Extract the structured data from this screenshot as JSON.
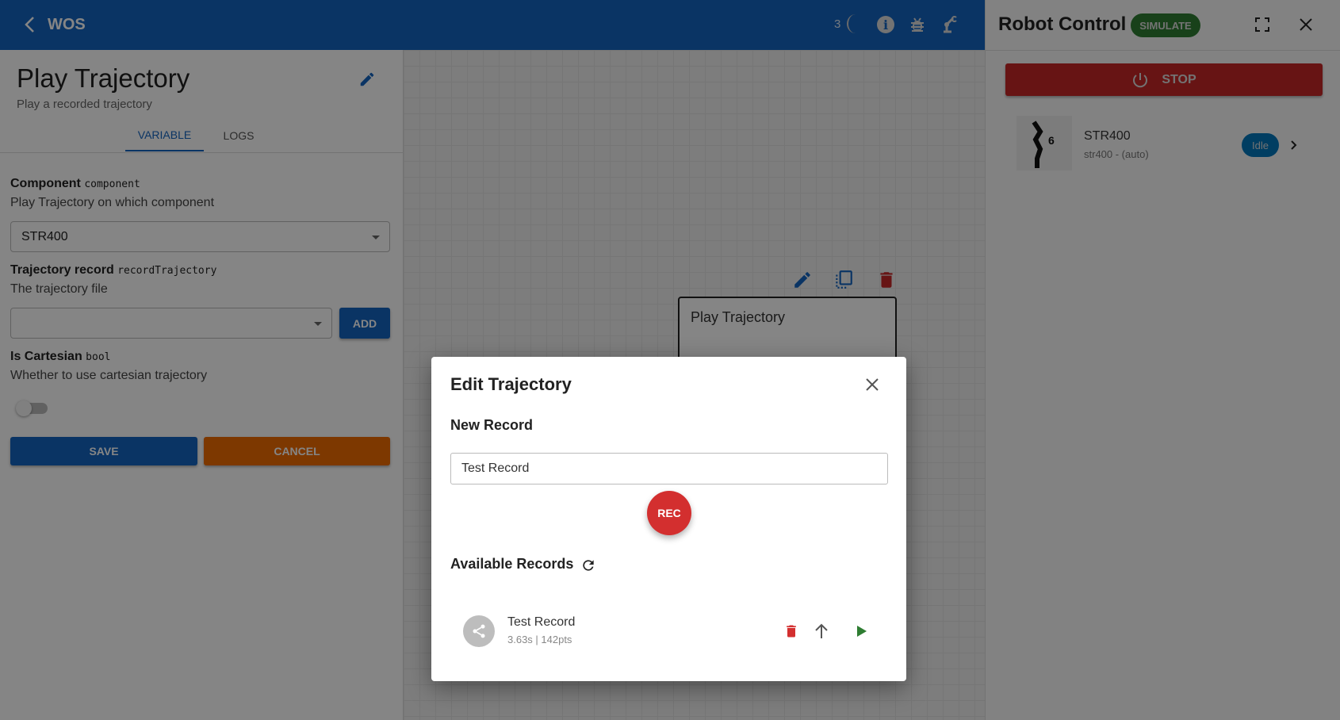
{
  "header": {
    "title": "WOS",
    "badge_count": "3",
    "icons": [
      "back-arrow-icon",
      "spinner-icon",
      "info-icon",
      "bug-icon",
      "robot-arm-icon"
    ]
  },
  "left_panel": {
    "title": "Play Trajectory",
    "subtitle": "Play a recorded trajectory",
    "tabs": [
      {
        "label": "VARIABLE",
        "active": true
      },
      {
        "label": "LOGS",
        "active": false
      }
    ],
    "fields": {
      "component": {
        "label": "Component",
        "var": "component",
        "description": "Play Trajectory on which component",
        "value": "STR400"
      },
      "trajectory": {
        "label": "Trajectory record",
        "var": "recordTrajectory",
        "description": "The trajectory file",
        "value": "",
        "add_label": "ADD"
      },
      "cartesian": {
        "label": "Is Cartesian",
        "var": "bool",
        "description": "Whether to use cartesian trajectory",
        "checked": false
      }
    },
    "save_label": "SAVE",
    "cancel_label": "CANCEL"
  },
  "canvas": {
    "node_title": "Play Trajectory"
  },
  "right_panel": {
    "title": "Robot Control",
    "mode_badge": "SIMULATE",
    "stop_label": "STOP",
    "robot": {
      "name": "STR400",
      "subtitle": "str400 - (auto)",
      "status": "Idle"
    }
  },
  "dialog": {
    "title": "Edit Trajectory",
    "new_record_heading": "New Record",
    "record_name_value": "Test Record",
    "rec_label": "REC",
    "available_heading": "Available Records",
    "records": [
      {
        "name": "Test Record",
        "meta": "3.63s | 142pts"
      }
    ]
  },
  "colors": {
    "primary": "#1565c0",
    "stop": "#c62828",
    "simulate": "#2e7d32",
    "cancel": "#ef6c00",
    "idle": "#0277bd",
    "rec": "#d32f2f",
    "play": "#2e7d32"
  }
}
